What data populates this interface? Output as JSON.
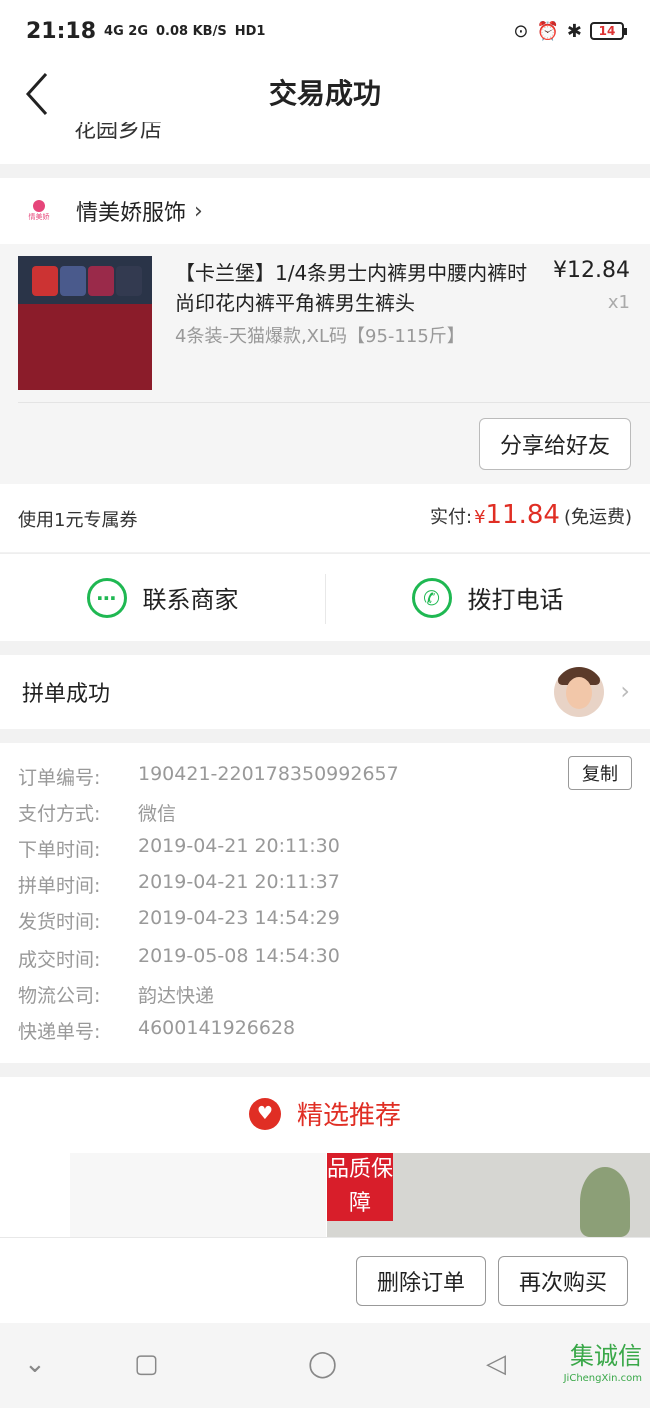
{
  "status_bar": {
    "time": "21:18",
    "signal": "4G 2G",
    "speed": "0.08 KB/S",
    "hd": "HD1",
    "battery": "14"
  },
  "nav": {
    "title": "交易成功"
  },
  "partial_text": "花园乡店",
  "shop": {
    "name": "情美娇服饰",
    "logo_text": "情美娇"
  },
  "product": {
    "name": "【卡兰堡】1/4条男士内裤男中腰内裤时尚印花内裤平角裤男生裤头",
    "spec": "4条装-天猫爆款,XL码【95-115斤】",
    "price": "¥12.84",
    "qty": "x1",
    "share_label": "分享给好友"
  },
  "payment": {
    "coupon": "使用1元专属券",
    "paid_label": "实付:",
    "currency": "¥",
    "amount": "11.84",
    "shipping": "(免运费)"
  },
  "contact": {
    "merchant": "联系商家",
    "phone": "拨打电话"
  },
  "group": {
    "label": "拼单成功"
  },
  "details": {
    "copy_label": "复制",
    "rows": [
      {
        "k": "订单编号:",
        "v": "190421-220178350992657"
      },
      {
        "k": "支付方式:",
        "v": "微信"
      },
      {
        "k": "下单时间:",
        "v": "2019-04-21 20:11:30"
      },
      {
        "k": "拼单时间:",
        "v": "2019-04-21 20:11:37"
      },
      {
        "k": "发货时间:",
        "v": "2019-04-23 14:54:29"
      },
      {
        "k": "成交时间:",
        "v": "2019-05-08 14:54:30"
      },
      {
        "k": "物流公司:",
        "v": "韵达快递"
      },
      {
        "k": "快递单号:",
        "v": "4600141926628"
      }
    ]
  },
  "recommend": {
    "title": "精选推荐",
    "badge": "品质保障"
  },
  "bottom": {
    "delete": "删除订单",
    "rebuy": "再次购买"
  },
  "watermark": {
    "big": "集诚信",
    "small": "JiChengXin.com"
  },
  "colors": {
    "accent": "#e02e24",
    "green": "#1fb852"
  }
}
